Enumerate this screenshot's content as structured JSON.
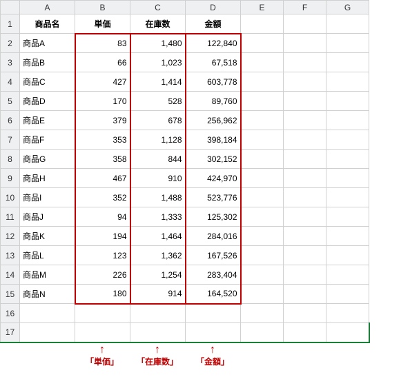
{
  "chart_data": {
    "type": "table",
    "title": "",
    "columns": [
      "商品名",
      "単価",
      "在庫数",
      "金額"
    ],
    "rows": [
      [
        "商品A",
        83,
        1480,
        122840
      ],
      [
        "商品B",
        66,
        1023,
        67518
      ],
      [
        "商品C",
        427,
        1414,
        603778
      ],
      [
        "商品D",
        170,
        528,
        89760
      ],
      [
        "商品E",
        379,
        678,
        256962
      ],
      [
        "商品F",
        353,
        1128,
        398184
      ],
      [
        "商品G",
        358,
        844,
        302152
      ],
      [
        "商品H",
        467,
        910,
        424970
      ],
      [
        "商品I",
        352,
        1488,
        523776
      ],
      [
        "商品J",
        94,
        1333,
        125302
      ],
      [
        "商品K",
        194,
        1464,
        284016
      ],
      [
        "商品L",
        123,
        1362,
        167526
      ],
      [
        "商品M",
        226,
        1254,
        283404
      ],
      [
        "商品N",
        180,
        914,
        164520
      ]
    ]
  },
  "col_letters": [
    "A",
    "B",
    "C",
    "D",
    "E",
    "F",
    "G"
  ],
  "row_numbers": [
    "1",
    "2",
    "3",
    "4",
    "5",
    "6",
    "7",
    "8",
    "9",
    "10",
    "11",
    "12",
    "13",
    "14",
    "15",
    "16",
    "17"
  ],
  "headers": {
    "a": "商品名",
    "b": "単価",
    "c": "在庫数",
    "d": "金額"
  },
  "rows": [
    {
      "name": "商品A",
      "price": "83",
      "stock": "1,480",
      "amount": "122,840"
    },
    {
      "name": "商品B",
      "price": "66",
      "stock": "1,023",
      "amount": "67,518"
    },
    {
      "name": "商品C",
      "price": "427",
      "stock": "1,414",
      "amount": "603,778"
    },
    {
      "name": "商品D",
      "price": "170",
      "stock": "528",
      "amount": "89,760"
    },
    {
      "name": "商品E",
      "price": "379",
      "stock": "678",
      "amount": "256,962"
    },
    {
      "name": "商品F",
      "price": "353",
      "stock": "1,128",
      "amount": "398,184"
    },
    {
      "name": "商品G",
      "price": "358",
      "stock": "844",
      "amount": "302,152"
    },
    {
      "name": "商品H",
      "price": "467",
      "stock": "910",
      "amount": "424,970"
    },
    {
      "name": "商品I",
      "price": "352",
      "stock": "1,488",
      "amount": "523,776"
    },
    {
      "name": "商品J",
      "price": "94",
      "stock": "1,333",
      "amount": "125,302"
    },
    {
      "name": "商品K",
      "price": "194",
      "stock": "1,464",
      "amount": "284,016"
    },
    {
      "name": "商品L",
      "price": "123",
      "stock": "1,362",
      "amount": "167,526"
    },
    {
      "name": "商品M",
      "price": "226",
      "stock": "1,254",
      "amount": "283,404"
    },
    {
      "name": "商品N",
      "price": "180",
      "stock": "914",
      "amount": "164,520"
    }
  ],
  "labels": {
    "b": "「単価」",
    "c": "「在庫数」",
    "d": "「金額」"
  }
}
